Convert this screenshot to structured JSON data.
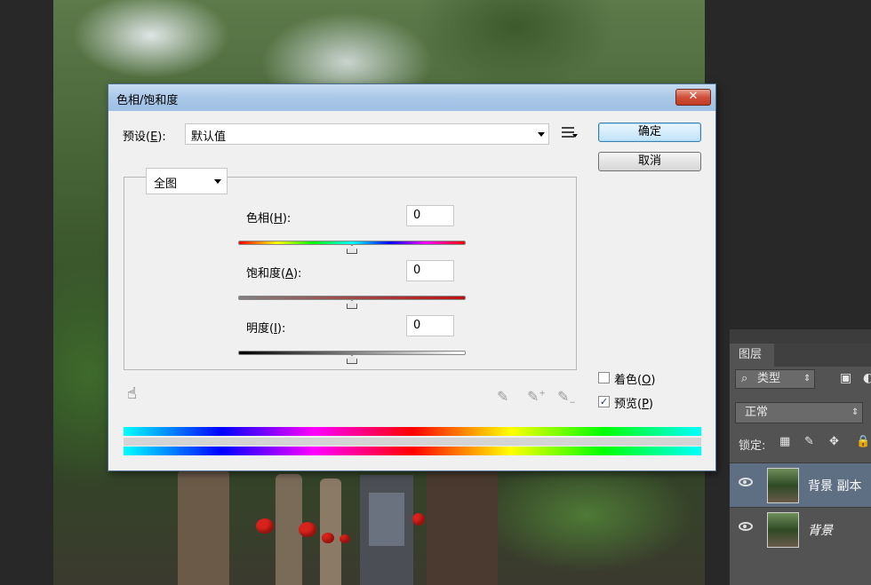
{
  "dialog": {
    "title": "色相/饱和度",
    "close_glyph": "✕",
    "preset_label": "预设(",
    "preset_mnemonic": "E",
    "preset_suffix": "):",
    "preset_value": "默认值",
    "ok_label": "确定",
    "cancel_label": "取消",
    "range_value": "全图",
    "sliders": [
      {
        "label": "色相(",
        "mnemonic": "H",
        "suffix": "):",
        "value": "0",
        "position_fraction": 0.5
      },
      {
        "label": "饱和度(",
        "mnemonic": "A",
        "suffix": "):",
        "value": "0",
        "position_fraction": 0.5
      },
      {
        "label": "明度(",
        "mnemonic": "I",
        "suffix": "):",
        "value": "0",
        "position_fraction": 0.5
      }
    ],
    "colorize": {
      "label": "着色(",
      "mnemonic": "O",
      "suffix": ")",
      "checked": false
    },
    "preview": {
      "label": "预览(",
      "mnemonic": "P",
      "suffix": ")",
      "checked": true
    }
  },
  "layers_panel": {
    "tab_label": "图层",
    "filter_icon": "search-icon",
    "filter_value": "类型",
    "blend_mode": "正常",
    "lock_label": "锁定:",
    "layers": [
      {
        "name": "背景 副本",
        "selected": true,
        "visible": true
      },
      {
        "name": "背景",
        "selected": false,
        "visible": true
      }
    ]
  },
  "colors": {
    "dialog_bg": "#f0f0f0",
    "titlebar": "#a9c7e8",
    "close_button": "#c23a22",
    "panel_bg": "#535353",
    "selected_layer": "#5e6f84"
  }
}
